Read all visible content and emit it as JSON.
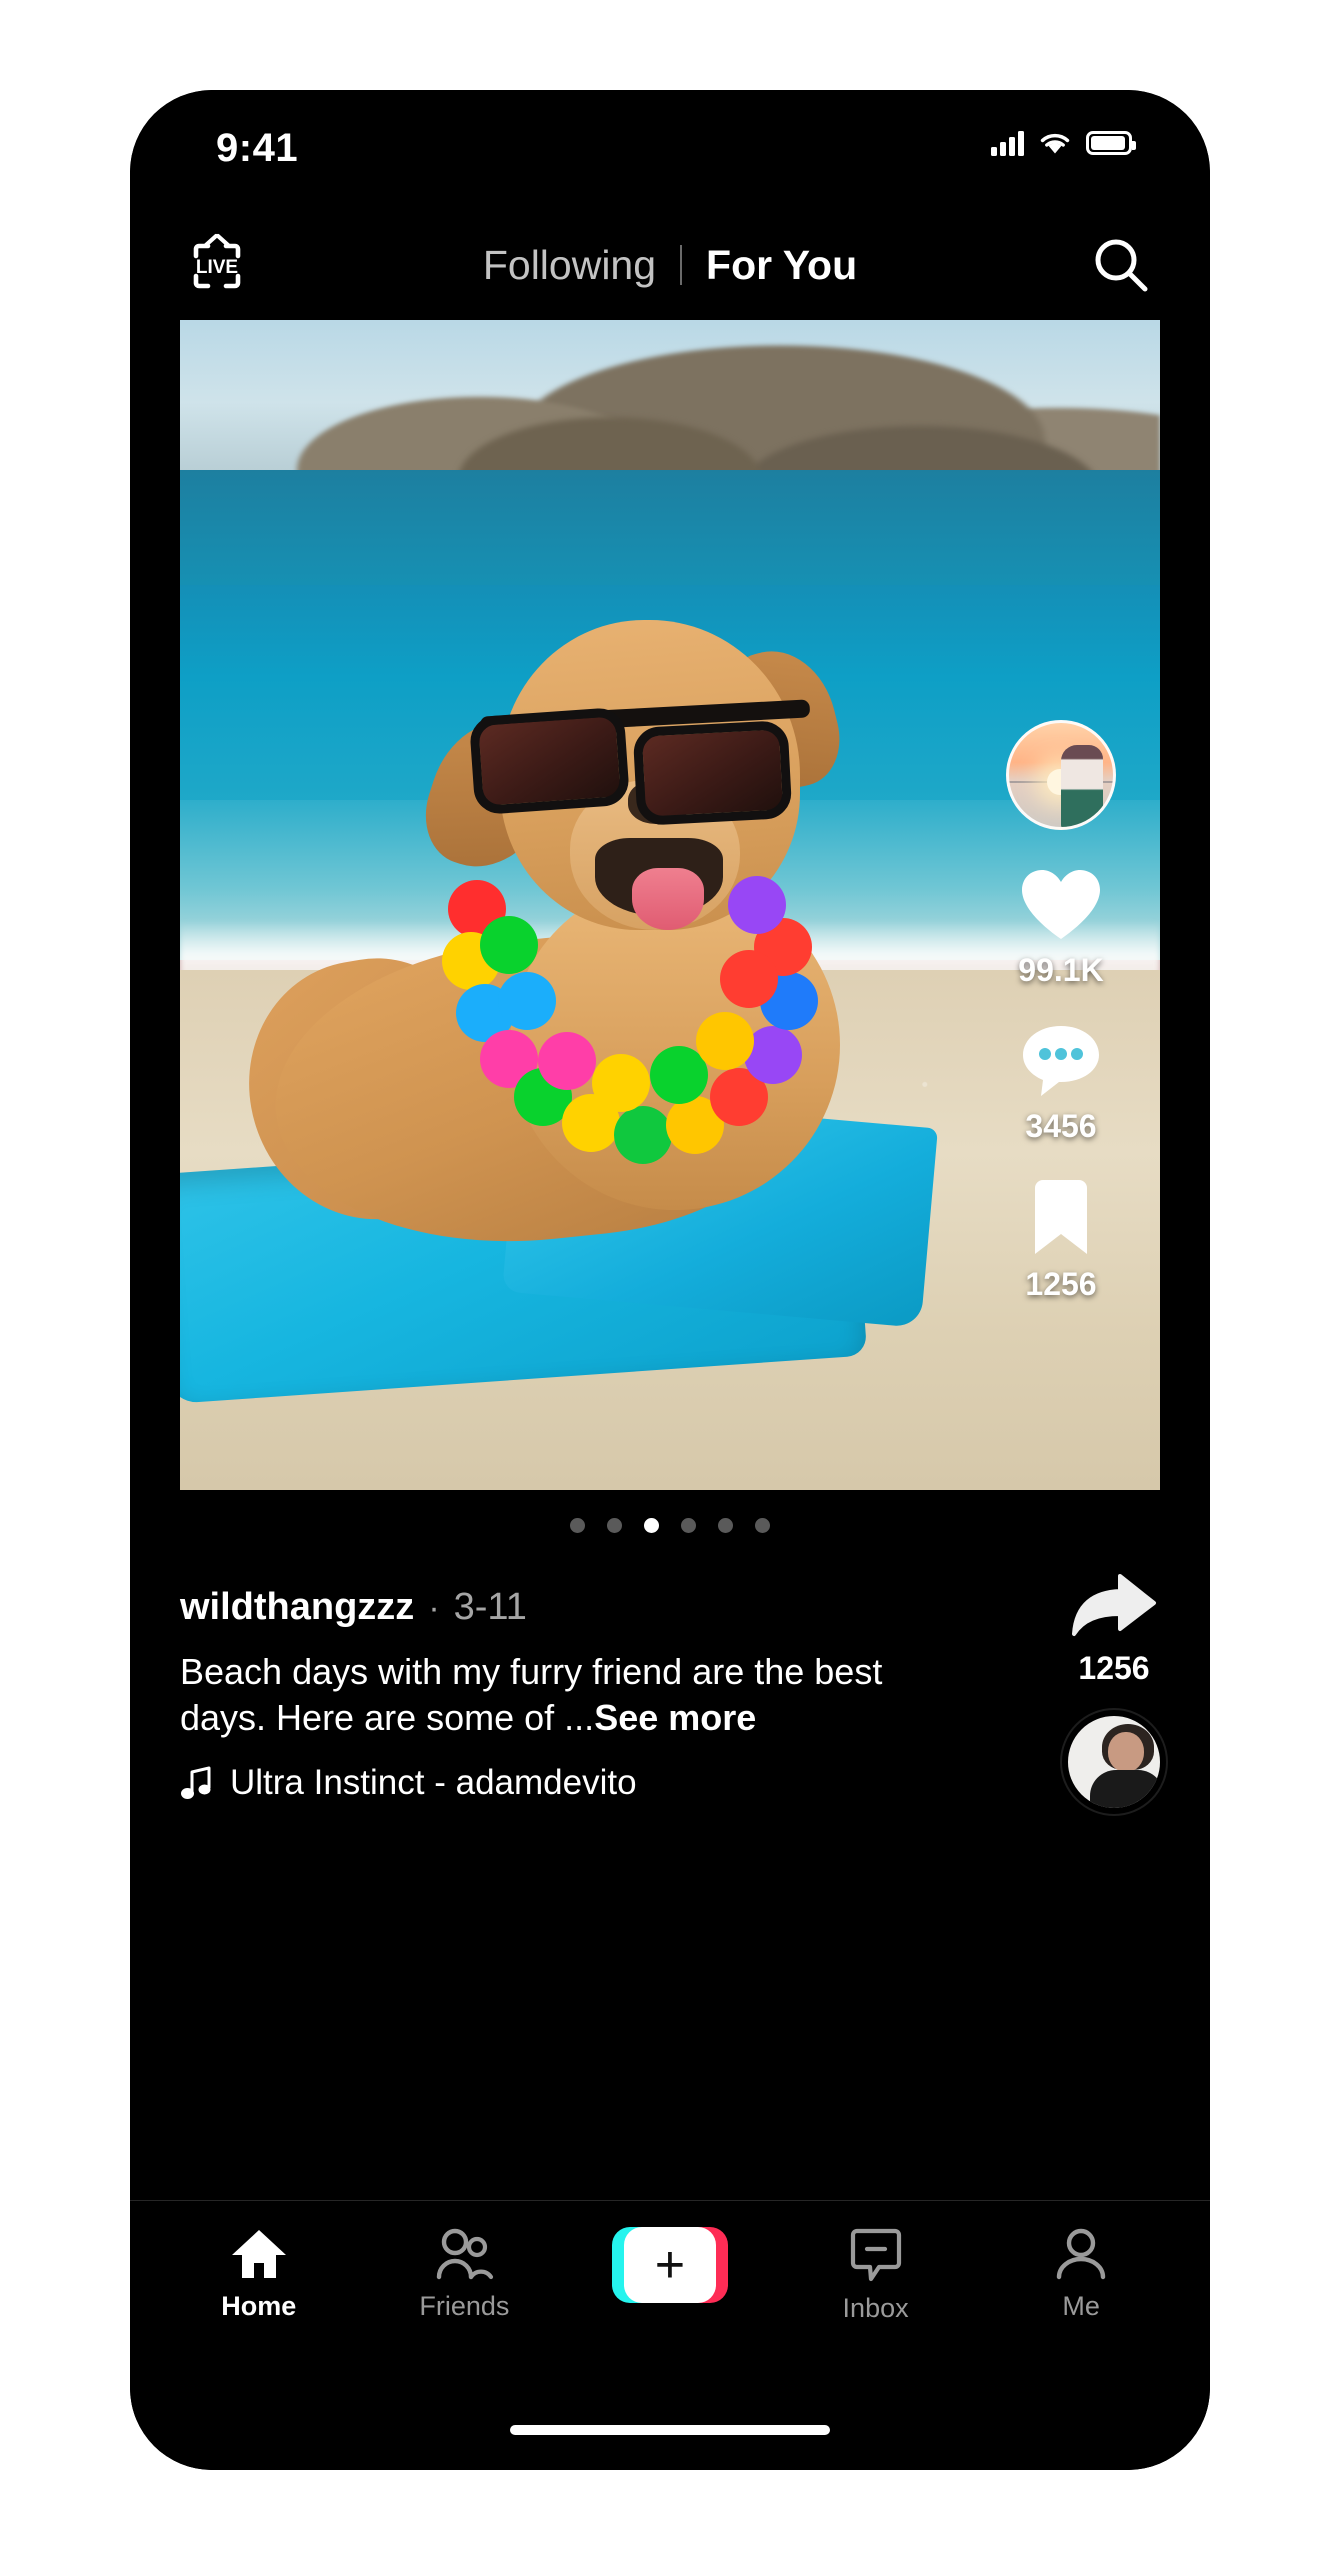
{
  "status_bar": {
    "time": "9:41",
    "icons": [
      "cellular-signal-icon",
      "wifi-icon",
      "battery-icon"
    ],
    "battery_level": 100
  },
  "top_nav": {
    "live_label": "LIVE",
    "live_icon": "live-tv-icon",
    "tabs": [
      {
        "label": "Following",
        "active": false
      },
      {
        "label": "For You",
        "active": true
      }
    ],
    "separator": "|",
    "search_icon": "search-icon"
  },
  "post": {
    "media_type": "photo-carousel",
    "pagination": {
      "total": 6,
      "active_index": 2
    },
    "username": "wildthangzzz",
    "meta_separator": "·",
    "date": "3-11",
    "caption": "Beach days with my furry friend are the best days. Here are some of ...",
    "see_more_label": "See more",
    "music_icon": "music-note-icon",
    "music": "Ultra Instinct - adamdevito",
    "creator_avatar_name": "creator-avatar",
    "comment_avatar_name": "comment-avatar"
  },
  "actions": [
    {
      "name": "like-button",
      "icon": "heart-icon",
      "count": "99.1K"
    },
    {
      "name": "comment-button",
      "icon": "comment-icon",
      "count": "3456"
    },
    {
      "name": "bookmark-button",
      "icon": "bookmark-icon",
      "count": "1256"
    },
    {
      "name": "share-button",
      "icon": "share-arrow-icon",
      "count": "1256"
    }
  ],
  "tab_bar": [
    {
      "label": "Home",
      "icon": "home-icon",
      "active": true
    },
    {
      "label": "Friends",
      "icon": "friends-icon",
      "active": false
    },
    {
      "label": "",
      "icon": "create-plus-icon",
      "active": false
    },
    {
      "label": "Inbox",
      "icon": "inbox-icon",
      "active": false
    },
    {
      "label": "Me",
      "icon": "profile-icon",
      "active": false
    }
  ],
  "colors": {
    "background": "#000000",
    "text_primary": "#ffffff",
    "text_secondary": "#a5a5a5",
    "tiktok_cyan": "#25f4ee",
    "tiktok_pink": "#fe2c55",
    "towel_blue": "#17b6e0"
  }
}
